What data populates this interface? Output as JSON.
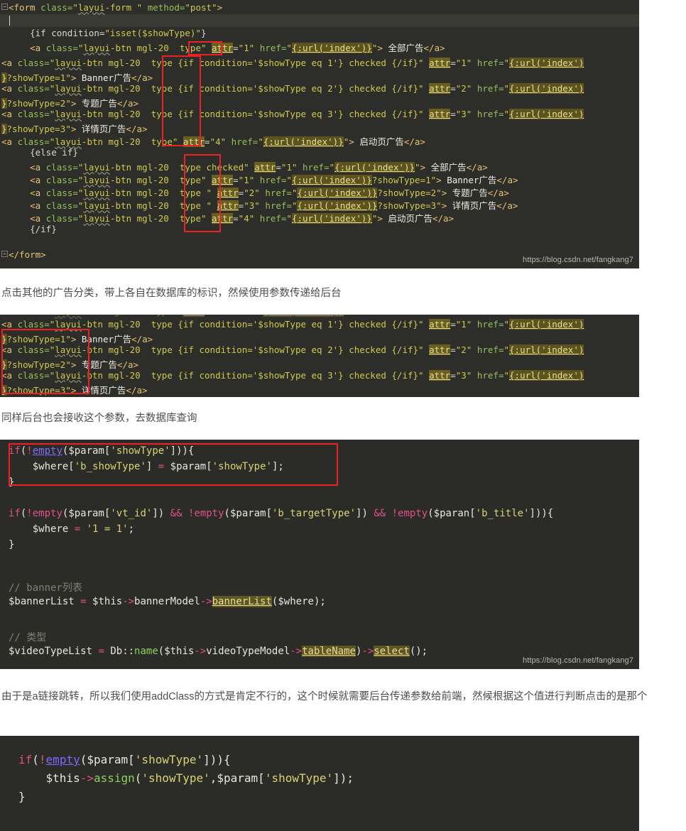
{
  "document": {
    "type": "blog-article-screenshot",
    "watermark": "https://blog.csdn.net/fangkang7"
  },
  "paragraphs": [
    {
      "id": "p1",
      "text": "点击其他的广告分类，带上各自在数据库的标识，然候使用参数传递给后台"
    },
    {
      "id": "p2",
      "text": "同样后台也会接收这个参数，去数据库查询"
    },
    {
      "id": "p3",
      "text": "由于是a链接跳转，所以我们使用addClass的方式是肯定不行的，这个时候就需要后台传递参数给前端，然候根据这个值进行判断点击的是那个"
    }
  ],
  "code_blocks": [
    {
      "id": "block1",
      "language": "html-template",
      "theme_background": "#2d2d2a",
      "watermark": "https://blog.csdn.net/fangkang7",
      "lines": [
        "<form class=\"layui-form \" method=\"post\">",
        "",
        "    {if condition=\"isset($showType)\"}",
        "    <a class=\"layui-btn mgl-20  type\" attr=\"1\" href=\"{:url('index')}\"> 全部广告</a>",
        "<a class=\"layui-btn mgl-20  type {if condition='$showType eq 1'} checked {/if}\" attr=\"1\" href=\"{:url('index')",
        "}?showType=1\"> Banner广告</a>",
        "<a class=\"layui-btn mgl-20  type {if condition='$showType eq 2'} checked {/if}\" attr=\"2\" href=\"{:url('index')",
        "}?showType=2\"> 专题广告</a>",
        "<a class=\"layui-btn mgl-20  type {if condition='$showType eq 3'} checked {/if}\" attr=\"3\" href=\"{:url('index')",
        "}?showType=3\"> 详情页广告</a>",
        "<a class=\"layui-btn mgl-20  type\" attr=\"4\" href=\"{:url('index')}\"> 启动页广告</a>",
        "    {else if}",
        "    <a class=\"layui-btn mgl-20  type checked\" attr=\"1\" href=\"{:url('index')}\"> 全部广告</a>",
        "    <a class=\"layui-btn mgl-20  type\" attr=\"1\" href=\"{:url('index')}?showType=1\"> Banner广告</a>",
        "    <a class=\"layui-btn mgl-20  type \" attr=\"2\" href=\"{:url('index')}?showType=2\"> 专题广告</a>",
        "    <a class=\"layui-btn mgl-20  type \" attr=\"3\" href=\"{:url('index')}?showType=3\"> 详情页广告</a>",
        "    <a class=\"layui-btn mgl-20  type\" attr=\"4\" href=\"{:url('index')}\"> 启动页广告</a>",
        "    {/if}",
        "",
        "</form>"
      ],
      "annotations": [
        {
          "shape": "rect",
          "label": "type-attribute-highlight-top"
        },
        {
          "shape": "rect",
          "label": "type-attribute-highlight-column"
        }
      ]
    },
    {
      "id": "block2",
      "language": "html-template",
      "theme_background": "#2d2d2a",
      "lines": [
        "<a class=\"layui-btn mgl-20  type {if condition='$showType eq 1'} checked {/if}\" attr=\"1\" href=\"{:url('index')",
        "}?showType=1\"> Banner广告</a>",
        "<a class=\"layui-btn mgl-20  type {if condition='$showType eq 2'} checked {/if}\" attr=\"2\" href=\"{:url('index')",
        "}?showType=2\"> 专题广告</a>",
        "<a class=\"layui-btn mgl-20  type {if condition='$showType eq 3'} checked {/if}\" attr=\"3\" href=\"{:url('index')",
        "}?showType=3\"> 详情页广告</a>"
      ],
      "annotations": [
        {
          "shape": "rect",
          "label": "showtype-param-highlight"
        }
      ]
    },
    {
      "id": "block3",
      "language": "php",
      "theme_background": "#2b2b28",
      "watermark": "https://blog.csdn.net/fangkang7",
      "lines": [
        "if(!empty($param['showType'])){",
        "    $where['b_showType'] = $param['showType'];",
        "}",
        "",
        "if(!empty($param['vt_id']) && !empty($param['b_targetType']) && !empty($paran['b_title'])){",
        "    $where = '1 = 1';",
        "}",
        "",
        "",
        "// banner列表",
        "$bannerList = $this->bannerModel->bannerList($where);",
        "",
        "// 类型",
        "$videoTypeList = Db::name($this->videoTypeModel->tableName)->select();"
      ],
      "annotations": [
        {
          "shape": "rect",
          "label": "showtype-where-highlight"
        }
      ]
    },
    {
      "id": "block4",
      "language": "php",
      "theme_background": "#2b2b28",
      "lines": [
        "if(!empty($param['showType'])){",
        "    $this->assign('showType',$param['showType']);",
        "}"
      ],
      "annotations": []
    }
  ],
  "colors": {
    "code_bg": "#2d2d2a",
    "annotation_red": "#ee2222",
    "prose_text": "#4d4d4d",
    "highlight_token": "#5c5320"
  }
}
